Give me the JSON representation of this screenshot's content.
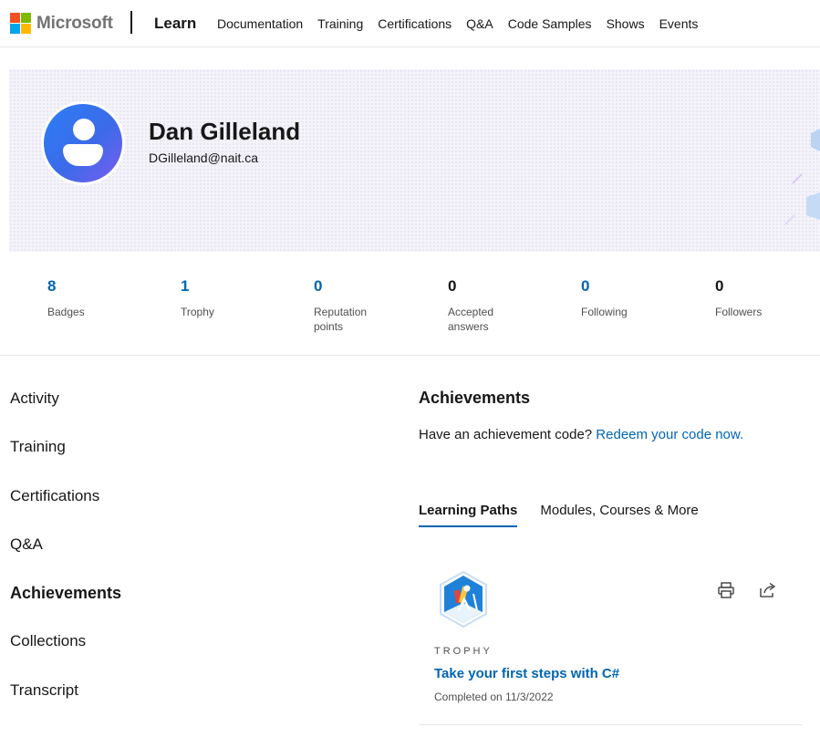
{
  "brand": {
    "company": "Microsoft",
    "product": "Learn",
    "logo_colors": [
      "#f25022",
      "#7fba00",
      "#00a4ef",
      "#ffb900"
    ]
  },
  "nav": [
    {
      "label": "Documentation"
    },
    {
      "label": "Training"
    },
    {
      "label": "Certifications"
    },
    {
      "label": "Q&A"
    },
    {
      "label": "Code Samples"
    },
    {
      "label": "Shows"
    },
    {
      "label": "Events"
    }
  ],
  "profile": {
    "name": "Dan Gilleland",
    "email": "DGilleland@nait.ca",
    "avatar_icon": "person-icon"
  },
  "stats": [
    {
      "value": "8",
      "label": "Badges",
      "color": "#0065b3"
    },
    {
      "value": "1",
      "label": "Trophy",
      "color": "#0065b3"
    },
    {
      "value": "0",
      "label": "Reputation points",
      "color": "#0065b3"
    },
    {
      "value": "0",
      "label": "Accepted answers",
      "color": "#171717"
    },
    {
      "value": "0",
      "label": "Following",
      "color": "#0065b3"
    },
    {
      "value": "0",
      "label": "Followers",
      "color": "#171717"
    }
  ],
  "sidenav": [
    {
      "label": "Activity"
    },
    {
      "label": "Training"
    },
    {
      "label": "Certifications"
    },
    {
      "label": "Q&A"
    },
    {
      "label": "Achievements"
    },
    {
      "label": "Collections"
    },
    {
      "label": "Transcript"
    }
  ],
  "achievements": {
    "title": "Achievements",
    "prompt": "Have an achievement code?",
    "redeem_link": "Redeem your code now.",
    "tabs": [
      {
        "label": "Learning Paths"
      },
      {
        "label": "Modules, Courses & More"
      }
    ],
    "card": {
      "kind": "TROPHY",
      "title": "Take your first steps with C#",
      "date": "Completed on 11/3/2022",
      "actions": [
        "print-icon",
        "share-icon"
      ]
    }
  },
  "colors": {
    "accent": "#0065b3",
    "text": "#171717"
  }
}
